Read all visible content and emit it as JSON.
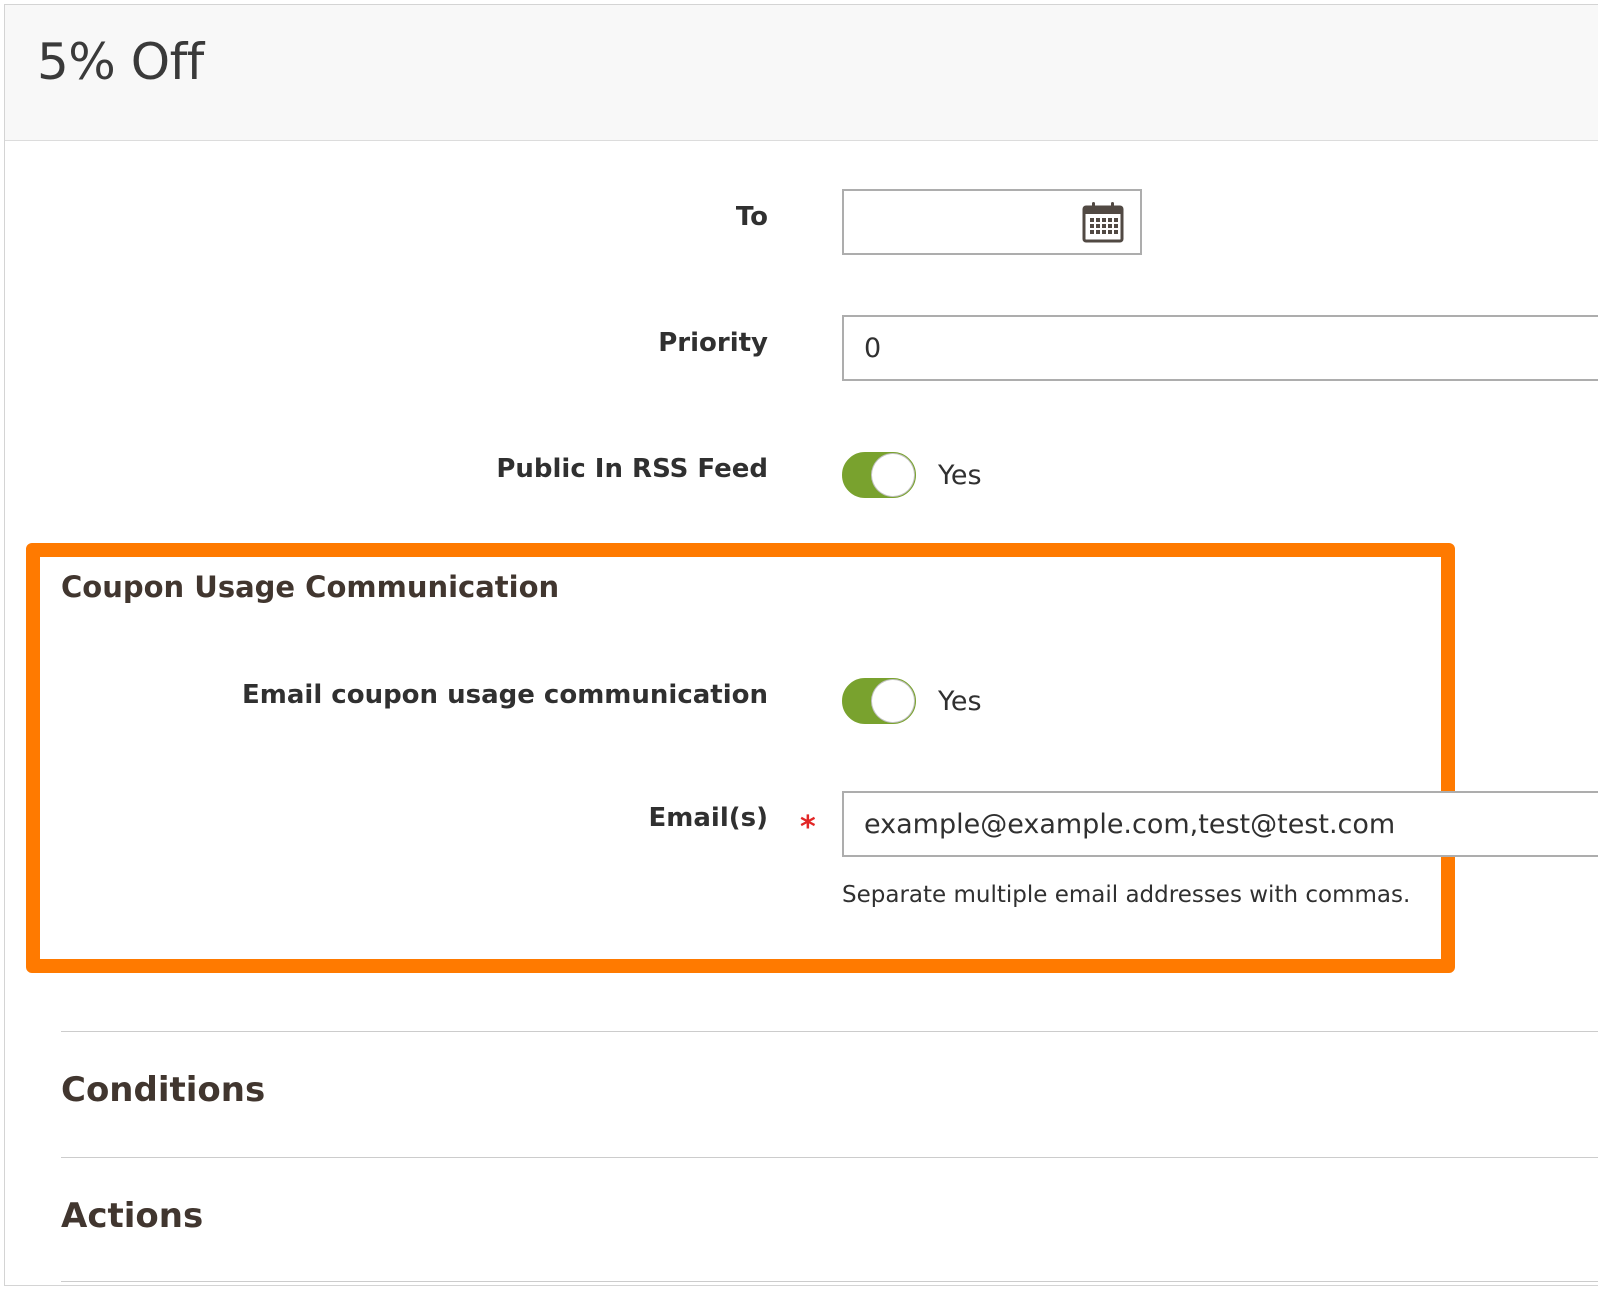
{
  "page": {
    "title": "5% Off"
  },
  "form": {
    "to": {
      "label": "To",
      "value": ""
    },
    "priority": {
      "label": "Priority",
      "value": "0"
    },
    "rss_feed": {
      "label": "Public In RSS Feed",
      "state": "Yes"
    }
  },
  "coupon_usage": {
    "section_title": "Coupon Usage Communication",
    "email_toggle": {
      "label": "Email coupon usage communication",
      "state": "Yes"
    },
    "emails": {
      "label": "Email(s)",
      "required_marker": "*",
      "value": "example@example.com,test@test.com",
      "note": "Separate multiple email addresses with commas."
    }
  },
  "sections": {
    "conditions": "Conditions",
    "actions": "Actions"
  },
  "icons": {
    "calendar": "calendar-icon"
  },
  "colors": {
    "toggle_on": "#79a22e",
    "highlight": "#ff7a00",
    "required": "#e22626",
    "header_bg": "#f8f8f8"
  }
}
